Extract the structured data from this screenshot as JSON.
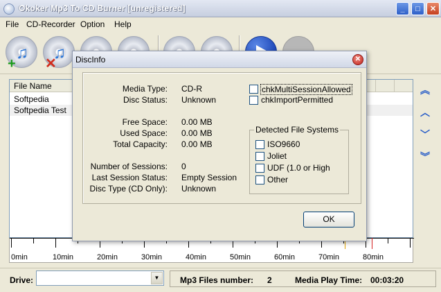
{
  "window": {
    "title": "Okoker Mp3 To CD Burner  [unregistered]",
    "buttons": {
      "minimize": "_",
      "maximize": "□",
      "close": "✕"
    }
  },
  "menu": {
    "items": [
      {
        "label": "File"
      },
      {
        "label": "CD-Recorder"
      },
      {
        "label": "Option"
      },
      {
        "label": "Help"
      }
    ]
  },
  "toolbar": {
    "buttons": [
      {
        "name": "add-files",
        "icon": "add-music-icon"
      },
      {
        "name": "remove-files",
        "icon": "remove-music-icon"
      },
      {
        "name": "disc-1",
        "icon": "disc-icon"
      },
      {
        "name": "disc-2",
        "icon": "disc-icon"
      },
      {
        "name": "disc-3",
        "icon": "disc-icon"
      },
      {
        "name": "disc-4",
        "icon": "disc-icon"
      },
      {
        "name": "burn",
        "icon": "play-icon"
      },
      {
        "name": "stop",
        "icon": "stop-icon"
      }
    ]
  },
  "list": {
    "columns": [
      "File Name"
    ],
    "rows": [
      {
        "name": "Softpedia"
      },
      {
        "name": "Softpedia Test"
      }
    ]
  },
  "nav_arrows": {
    "top": "︽",
    "up": "︿",
    "down": "﹀",
    "bottom": "︾"
  },
  "ruler": {
    "labels": [
      "0min",
      "10min",
      "20min",
      "30min",
      "40min",
      "50min",
      "60min",
      "70min",
      "80min"
    ]
  },
  "status": {
    "drive_label": "Drive:",
    "drive_value": "",
    "mp3_files_label": "Mp3 Files number:",
    "mp3_files_count": "2",
    "media_time_label": "Media Play Time:",
    "media_time_value": "00:03:20"
  },
  "dialog": {
    "title": "DiscInfo",
    "fields": {
      "media_type_label": "Media Type:",
      "media_type_value": "CD-R",
      "disc_status_label": "Disc Status:",
      "disc_status_value": "Unknown",
      "free_space_label": "Free Space:",
      "free_space_value": "0.00 MB",
      "used_space_label": "Used Space:",
      "used_space_value": "0.00 MB",
      "total_capacity_label": "Total Capacity:",
      "total_capacity_value": "0.00 MB",
      "sessions_label": "Number of Sessions:",
      "sessions_value": "0",
      "last_session_label": "Last Session Status:",
      "last_session_value": "Empty Session",
      "disc_type_label": "Disc Type (CD Only):",
      "disc_type_value": "Unknown"
    },
    "checkboxes": {
      "multisession": "chkMultiSessionAllowed",
      "import_permitted": "chkImportPermitted"
    },
    "file_systems": {
      "legend": "Detected File Systems",
      "items": [
        "ISO9660",
        "Joliet",
        "UDF (1.0 or High",
        "Other"
      ]
    },
    "ok_label": "OK"
  }
}
